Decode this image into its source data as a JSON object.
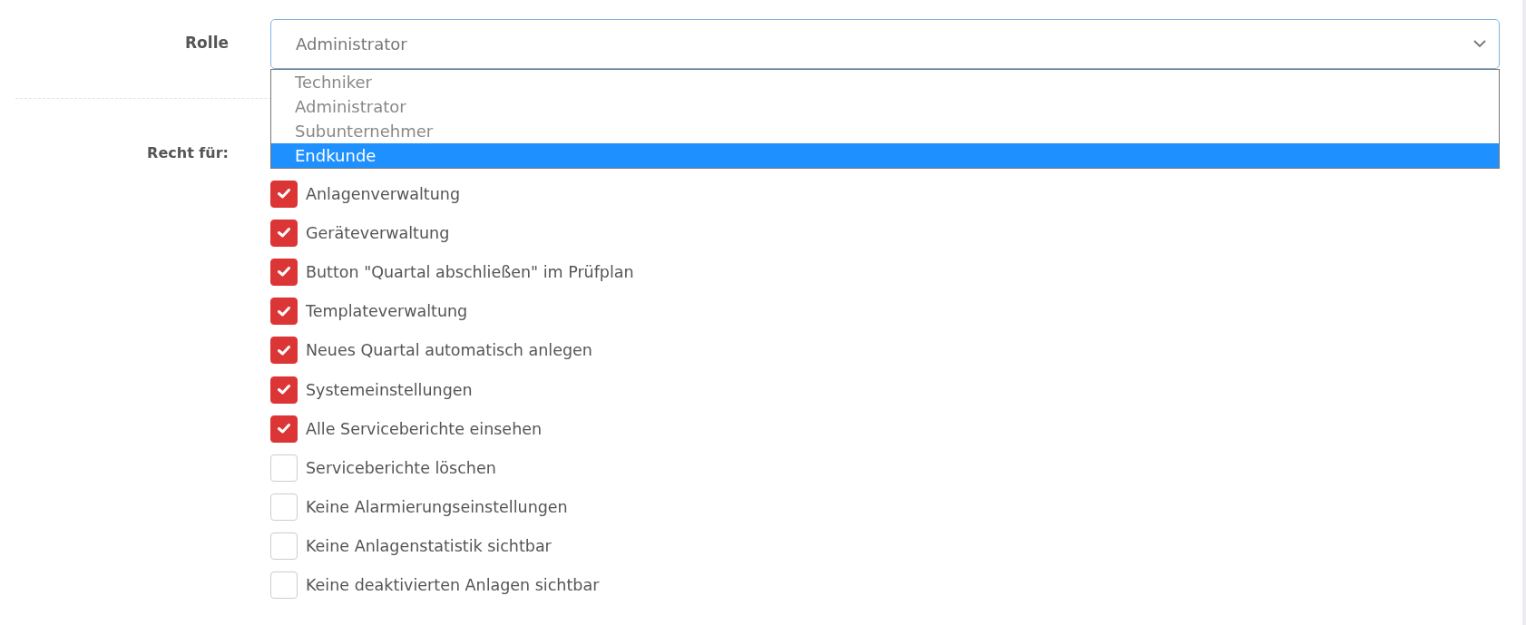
{
  "role": {
    "label": "Rolle",
    "value": "Administrator",
    "expanded": true,
    "options": [
      {
        "label": "Techniker",
        "highlighted": false
      },
      {
        "label": "Administrator",
        "highlighted": false
      },
      {
        "label": "Subunternehmer",
        "highlighted": false
      },
      {
        "label": "Endkunde",
        "highlighted": true
      }
    ]
  },
  "rights": {
    "label": "Recht für:",
    "items": [
      {
        "label": "Anlagenverwaltung",
        "checked": true
      },
      {
        "label": "Geräteverwaltung",
        "checked": true
      },
      {
        "label": "Button \"Quartal abschließen\" im Prüfplan",
        "checked": true
      },
      {
        "label": "Templateverwaltung",
        "checked": true
      },
      {
        "label": "Neues Quartal automatisch anlegen",
        "checked": true
      },
      {
        "label": "Systemeinstellungen",
        "checked": true
      },
      {
        "label": "Alle Serviceberichte einsehen",
        "checked": true
      },
      {
        "label": "Serviceberichte löschen",
        "checked": false
      },
      {
        "label": "Keine Alarmierungseinstellungen",
        "checked": false
      },
      {
        "label": "Keine Anlagenstatistik sichtbar",
        "checked": false
      },
      {
        "label": "Keine deaktivierten Anlagen sichtbar",
        "checked": false
      }
    ]
  }
}
